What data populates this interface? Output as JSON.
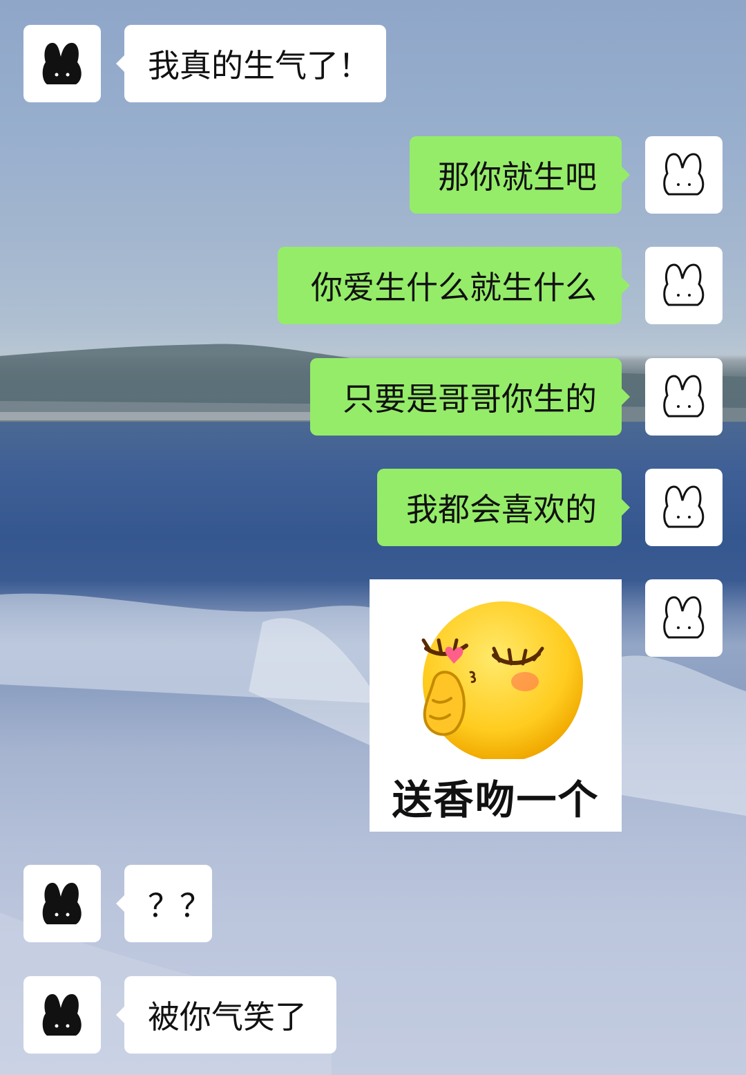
{
  "messages": [
    {
      "side": "left",
      "text": "我真的生气了！",
      "avatar": "black-bunny-icon"
    },
    {
      "side": "right",
      "text": "那你就生吧",
      "avatar": "white-bunny-icon"
    },
    {
      "side": "right",
      "text": "你爱生什么就生什么",
      "avatar": "white-bunny-icon"
    },
    {
      "side": "right",
      "text": "只要是哥哥你生的",
      "avatar": "white-bunny-icon"
    },
    {
      "side": "right",
      "text": "我都会喜欢的",
      "avatar": "white-bunny-icon"
    },
    {
      "side": "right",
      "type": "sticker",
      "caption": "送香吻一个",
      "avatar": "white-bunny-icon",
      "sticker_icon": "kissing-face-emoji"
    },
    {
      "side": "left",
      "text": "？？",
      "avatar": "black-bunny-icon"
    },
    {
      "side": "left",
      "text": "被你气笑了",
      "avatar": "black-bunny-icon"
    }
  ],
  "colors": {
    "sent_bubble": "#95ec69",
    "received_bubble": "#ffffff"
  }
}
